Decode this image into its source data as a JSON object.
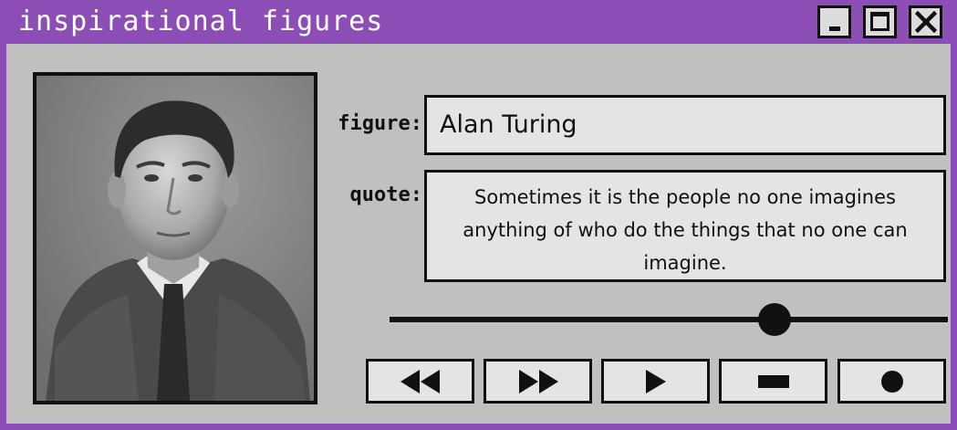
{
  "window": {
    "title": "inspirational figures",
    "controls": [
      "minimize-icon",
      "maximize-icon",
      "close-icon"
    ],
    "colors": {
      "titlebar": "#8c4db6",
      "body": "#c0c0c0",
      "field": "#e4e4e4"
    }
  },
  "photo": {
    "subject": "portrait photo",
    "style": "black-and-white"
  },
  "form": {
    "figure_label": "figure:",
    "figure_value": "Alan Turing",
    "quote_label": "quote:",
    "quote_value": "Sometimes it is the people no one imagines anything of who do the things that no one can imagine."
  },
  "player": {
    "slider_position": 0.69,
    "buttons": [
      "rewind-icon",
      "fast-forward-icon",
      "play-icon",
      "stop-icon",
      "record-icon"
    ]
  }
}
